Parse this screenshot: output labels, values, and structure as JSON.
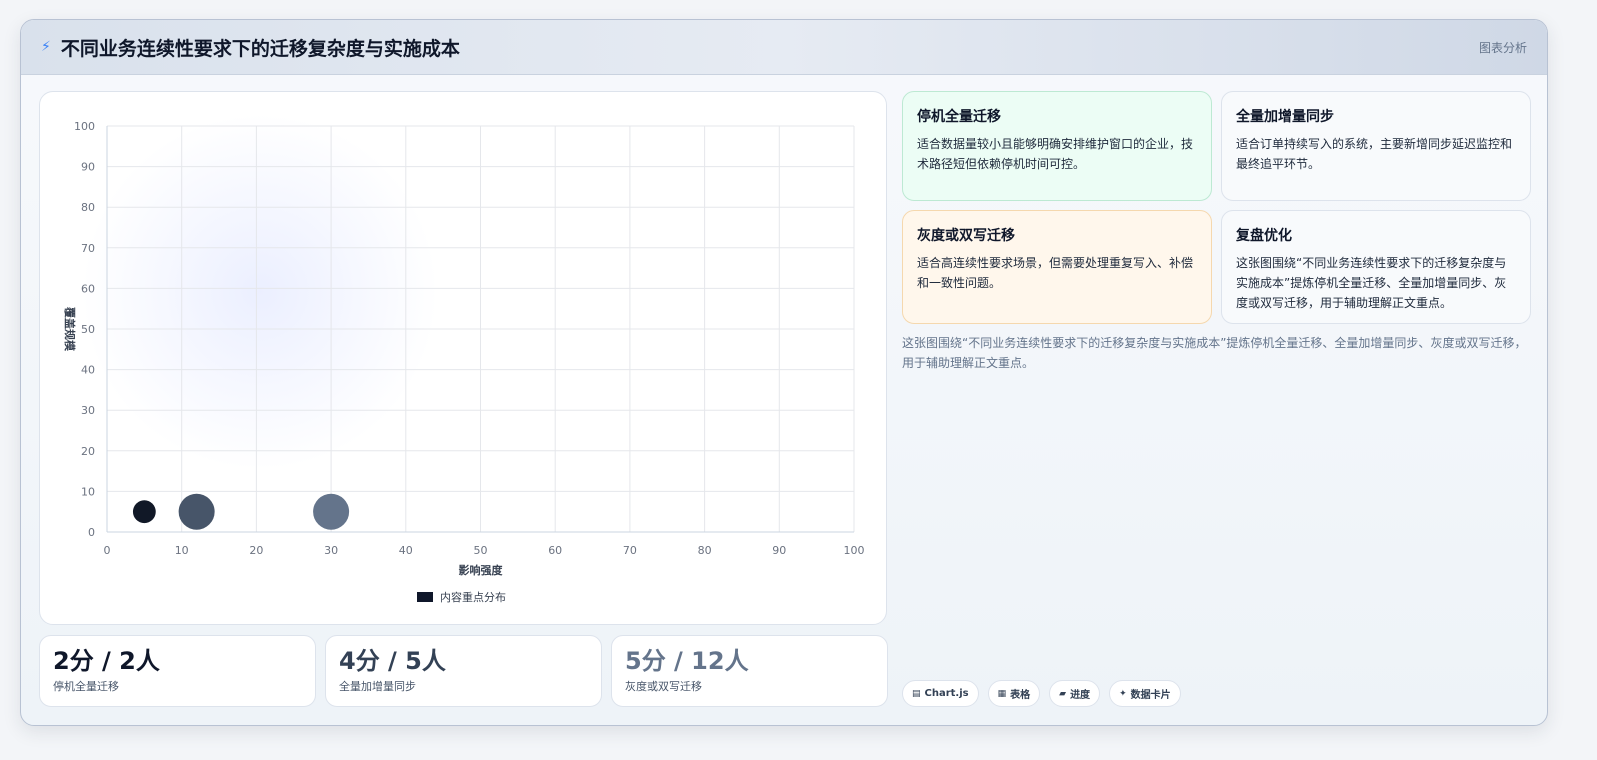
{
  "header": {
    "title": "不同业务连续性要求下的迁移复杂度与实施成本",
    "tag": "图表分析"
  },
  "chart_data": {
    "type": "scatter",
    "xlabel": "影响强度",
    "ylabel": "覆盖规模",
    "xlim": [
      0,
      100
    ],
    "ylim": [
      0,
      100
    ],
    "xticks": [
      0,
      10,
      20,
      30,
      40,
      50,
      60,
      70,
      80,
      90,
      100
    ],
    "yticks": [
      0,
      10,
      20,
      30,
      40,
      50,
      60,
      70,
      80,
      90,
      100
    ],
    "grid": true,
    "legend_position": "bottom",
    "series": [
      {
        "name": "内容重点分布",
        "points": [
          {
            "x": 5,
            "y": 5,
            "r": 2,
            "color": "#111827"
          },
          {
            "x": 12,
            "y": 5,
            "r": 5,
            "color": "#475569"
          },
          {
            "x": 30,
            "y": 5,
            "r": 5,
            "color": "#64748b"
          }
        ]
      }
    ],
    "legend_color": "#0f172a"
  },
  "stats": [
    {
      "value": "2分 / 2人",
      "label": "停机全量迁移",
      "color": "#0f172a"
    },
    {
      "value": "4分 / 5人",
      "label": "全量加增量同步",
      "color": "#334155"
    },
    {
      "value": "5分 / 12人",
      "label": "灰度或双写迁移",
      "color": "#64748b"
    }
  ],
  "cards": [
    {
      "title": "停机全量迁移",
      "text": "适合数据量较小且能够明确安排维护窗口的企业，技术路径短但依赖停机时间可控。"
    },
    {
      "title": "全量加增量同步",
      "text": "适合订单持续写入的系统，主要新增同步延迟监控和最终追平环节。"
    },
    {
      "title": "灰度或双写迁移",
      "text": "适合高连续性要求场景，但需要处理重复写入、补偿和一致性问题。"
    },
    {
      "title": "复盘优化",
      "text": "这张图围绕“不同业务连续性要求下的迁移复杂度与实施成本”提炼停机全量迁移、全量加增量同步、灰度或双写迁移，用于辅助理解正文重点。"
    }
  ],
  "summary": "这张图围绕“不同业务连续性要求下的迁移复杂度与实施成本”提炼停机全量迁移、全量加增量同步、灰度或双写迁移，用于辅助理解正文重点。",
  "tags": [
    {
      "icon": "chart-icon",
      "glyph": "▤",
      "label": "Chart.js"
    },
    {
      "icon": "table-icon",
      "glyph": "▦",
      "label": "表格"
    },
    {
      "icon": "progress-icon",
      "glyph": "▰",
      "label": "进度"
    },
    {
      "icon": "sparkle-icon",
      "glyph": "✦",
      "label": "数据卡片"
    }
  ]
}
